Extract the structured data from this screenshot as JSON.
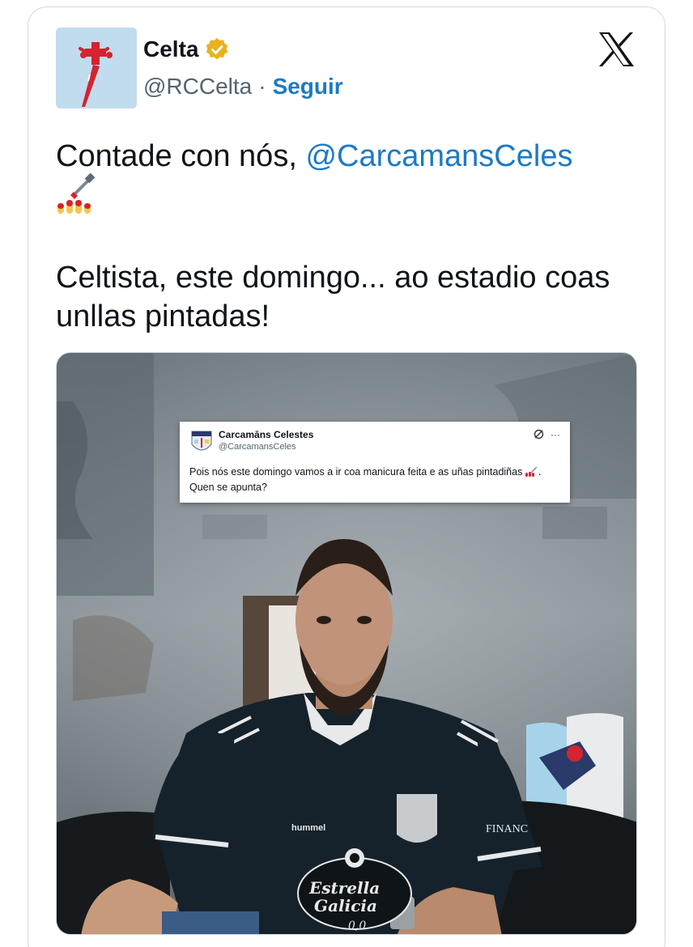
{
  "tweet": {
    "author": {
      "name": "Celta",
      "handle": "@RCCelta",
      "separator": "·",
      "follow_label": "Seguir",
      "verified_badge": "gold-checkmark-icon"
    },
    "platform_icon": "x-logo-icon",
    "text_prefix": "Contade con nós, ",
    "mention": "@CarcamansCeles",
    "emoji": "nail-polish-emoji",
    "text_line2": "Celtista, este domingo... ao estadio coas unllas pintadas!"
  },
  "embedded_tweet": {
    "name": "Carcamāns Celestes",
    "handle": "@CarcamansCeles",
    "icons": [
      "grok-icon",
      "more-icon"
    ],
    "more_glyph": "···",
    "text_part1": "Pois nós este domingo vamos a ir coa manicura feita e as uñas pintadiñas",
    "text_part2": ". Quen se apunta?"
  },
  "photo": {
    "jersey_brand": "hummel",
    "sponsor_line1": "Estrella",
    "sponsor_line2": "Galicia",
    "sponsor_sub": "0,0",
    "sleeve_text": "FINANC"
  },
  "colors": {
    "link": "#1d7ac4",
    "verified_gold": "#e8b21b",
    "celta_red": "#d5232f",
    "sky_blue": "#b9d6ea"
  }
}
